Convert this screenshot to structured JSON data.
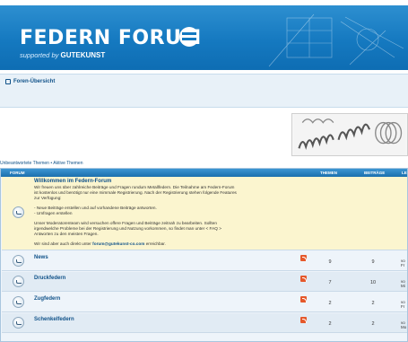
{
  "header": {
    "logo_text": "FEDERN FORUM",
    "tagline_prefix": "supported by",
    "tagline_brand": "GUTEKUNST",
    "brand_color": "#1579c0"
  },
  "breadcrumb": {
    "home_label": "Foren-Übersicht",
    "icon": "home-icon"
  },
  "quicklinks": {
    "unanswered": "Unbeantwortete Themen",
    "separator": "•",
    "active": "Aktive Themen"
  },
  "table": {
    "headers": {
      "forum": "FORUM",
      "topics": "THEMEN",
      "posts": "BEITRÄGE",
      "last": "LE"
    },
    "announcement": {
      "title": "Willkommen im Federn-Forum",
      "lines": [
        "Wir freuen uns über zahlreiche Beiträge und Fragen rundum Metallfedern. Die Teilnahme am Federn-Forum",
        "ist kostenlos und benötigt nur eine mimmale Registrierung. Nach der Registrierung stehen folgende Features",
        "zur Verfügung:",
        "",
        "- Neue Beiträge erstellen und auf vorhandene Beiträge antworten.",
        "- Umfragen erstellen",
        "",
        "Unser Moderatorenteam wird versuchen offere Fragen und Beiträge zeitnah zu bearbeiten. Sollten",
        "irgendwelche Probleme bei der Registrierung und Nutzung vorkommen, so findet man unter < FAQ >",
        "Antworten zu den meisten Fragen.",
        ""
      ],
      "contact_prefix": "Wir sind aber auch direkt unter",
      "contact_email": "forum@gutekunst-co.com",
      "contact_suffix": "erreichbar."
    },
    "forums": [
      {
        "title": "News",
        "topics": "9",
        "posts": "9",
        "last_line1": "vo",
        "last_line2": "Fr"
      },
      {
        "title": "Druckfedern",
        "topics": "7",
        "posts": "10",
        "last_line1": "vo",
        "last_line2": "Mi"
      },
      {
        "title": "Zugfedern",
        "topics": "2",
        "posts": "2",
        "last_line1": "vo",
        "last_line2": "Fr"
      },
      {
        "title": "Schenkelfedern",
        "topics": "2",
        "posts": "2",
        "last_line1": "vo",
        "last_line2": "Mo"
      }
    ]
  }
}
